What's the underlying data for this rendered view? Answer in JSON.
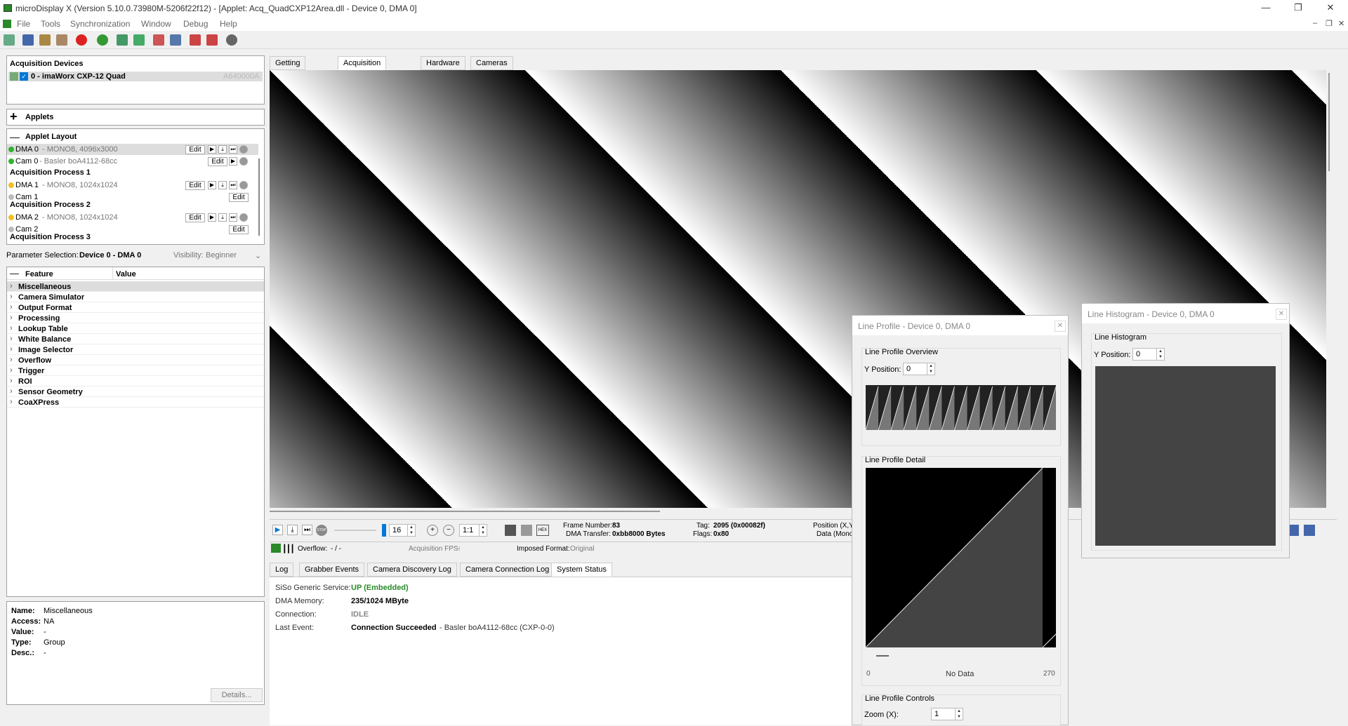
{
  "window": {
    "title": "microDisplay X (Version 5.10.0.73980M-5206f22f12) - [Applet: Acq_QuadCXP12Area.dll - Device 0, DMA 0]",
    "minimize": "—",
    "restore": "❐",
    "close": "✕"
  },
  "menu": {
    "items": [
      "File",
      "Tools",
      "Synchronization",
      "Window",
      "Debug",
      "Help"
    ],
    "mdi_min": "–",
    "mdi_restore": "❐",
    "mdi_close": "✕"
  },
  "acquisition_devices": {
    "header": "Acquisition Devices",
    "device_label": "0 - imaWorx CXP-12 Quad",
    "device_serial": "A640000A"
  },
  "applets": {
    "header": "Applets"
  },
  "applet_layout": {
    "header": "Applet Layout",
    "rows": [
      {
        "name": "DMA 0",
        "info": " - MONO8, 4096x3000",
        "status": "green",
        "edit": "Edit",
        "selected": true
      },
      {
        "name": "Cam 0",
        "info": " - Basler boA4112-68cc",
        "status": "green",
        "edit": "Edit"
      },
      {
        "group": "Acquisition Process 1"
      },
      {
        "name": "DMA 1",
        "info": " - MONO8, 1024x1024",
        "status": "yellow",
        "edit": "Edit"
      },
      {
        "name": "Cam 1",
        "info": "",
        "status": "gray",
        "edit": "Edit"
      },
      {
        "group": "Acquisition Process 2"
      },
      {
        "name": "DMA 2",
        "info": " - MONO8, 1024x1024",
        "status": "yellow",
        "edit": "Edit"
      },
      {
        "name": "Cam 2",
        "info": "",
        "status": "gray",
        "edit": "Edit"
      },
      {
        "group": "Acquisition Process 3"
      }
    ]
  },
  "param_selection": {
    "label": "Parameter Selection:",
    "value": "Device 0 - DMA 0",
    "visibility_label": "Visibility:",
    "visibility_value": "Beginner"
  },
  "feature_tree": {
    "col_feature": "Feature",
    "col_value": "Value",
    "items": [
      "Miscellaneous",
      "Camera Simulator",
      "Output Format",
      "Processing",
      "Lookup Table",
      "White Balance",
      "Image Selector",
      "Overflow",
      "Trigger",
      "ROI",
      "Sensor Geometry",
      "CoaXPress"
    ]
  },
  "details": {
    "name_label": "Name:",
    "name_value": "Miscellaneous",
    "access_label": "Access:",
    "access_value": "NA",
    "value_label": "Value:",
    "value_value": "-",
    "type_label": "Type:",
    "type_value": "Group",
    "desc_label": "Desc.:",
    "desc_value": "-",
    "details_button": "Details..."
  },
  "main_tabs": [
    "Getting Started",
    "Acquisition Channel",
    "Hardware",
    "Cameras"
  ],
  "playback": {
    "buffer_value": "16",
    "zoom_ratio": "1:1",
    "frame_number_label": "Frame Number:",
    "frame_number": "83",
    "dma_transfer_label": "DMA Transfer:",
    "dma_transfer": "0xbb8000 Bytes",
    "tag_label": "Tag:",
    "tag": "2095 (0x00082f)",
    "flags_label": "Flags:",
    "flags": "0x80",
    "position_label": "Position (X,Y)",
    "data_label": "Data (Mono)",
    "overflow_label": "Overflow:",
    "overflow": "- / -",
    "acq_fps_label": "Acquisition FPS:",
    "acq_fps": "-",
    "imposed_format_label": "Imposed Format:",
    "imposed_format": "Original",
    "stop_label": "STOP",
    "hex_label": "HEX"
  },
  "log_tabs": [
    "Log",
    "Grabber Events",
    "Camera Discovery Log",
    "Camera Connection Log",
    "System Status"
  ],
  "system_status": {
    "service_label": "SiSo Generic Service:",
    "service_value": "UP (Embedded)",
    "dma_mem_label": "DMA Memory:",
    "dma_mem_value": "235/1024 MByte",
    "connection_label": "Connection:",
    "connection_value": "IDLE",
    "last_event_label": "Last Event:",
    "last_event_value": "Connection Succeeded",
    "last_event_detail": " - Basler boA4112-68cc (CXP-0-0)"
  },
  "line_profile": {
    "title": "Line Profile - Device 0, DMA 0",
    "overview_group": "Line Profile Overview",
    "y_pos_label": "Y Position:",
    "y_pos_value": "0",
    "detail_group": "Line Profile Detail",
    "axis_min": "0",
    "axis_max": "270",
    "no_data": "No Data",
    "controls_group": "Line Profile Controls",
    "zoom_label": "Zoom (X):",
    "zoom_value": "1"
  },
  "line_histogram": {
    "title": "Line Histogram - Device 0, DMA 0",
    "group": "Line Histogram",
    "y_pos_label": "Y Position:",
    "y_pos_value": "0"
  },
  "colors": {
    "accent": "#0078d7",
    "status_green": "#2db52d",
    "status_yellow": "#f0c020",
    "up_green": "#2a8a2a"
  }
}
